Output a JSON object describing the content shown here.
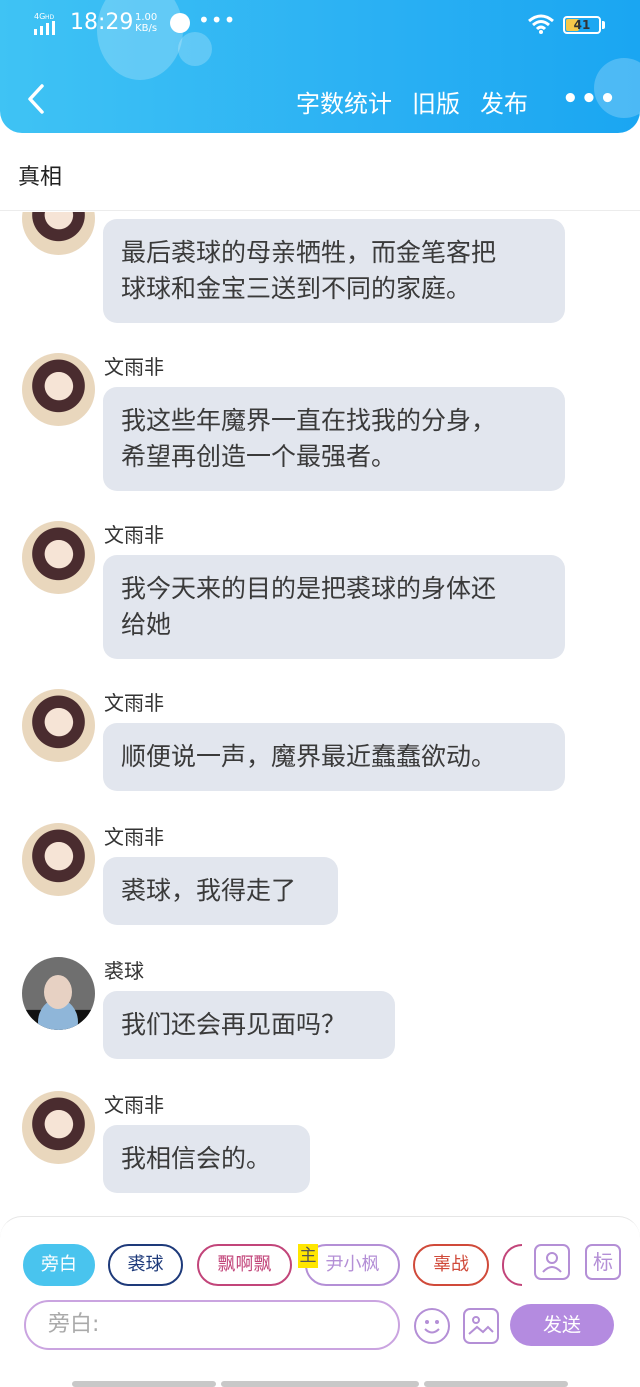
{
  "status_bar": {
    "network": "4G",
    "network_hd": "HD",
    "time": "18:29",
    "speed_value": "1.00",
    "speed_unit": "KB/s",
    "more": "•••",
    "battery": "41"
  },
  "header": {
    "actions": [
      "字数统计",
      "旧版",
      "发布"
    ],
    "more": "•••"
  },
  "story_title": "真相",
  "messages": [
    {
      "speaker": "",
      "avatar": "girl-avatar",
      "text": "最后裘球的母亲牺牲，而金笔客把\n球球和金宝三送到不同的家庭。"
    },
    {
      "speaker": "文雨非",
      "avatar": "girl-avatar",
      "text": "我这些年魔界一直在找我的分身，\n希望再创造一个最强者。"
    },
    {
      "speaker": "文雨非",
      "avatar": "girl-avatar",
      "text": "我今天来的目的是把裘球的身体还\n给她"
    },
    {
      "speaker": "文雨非",
      "avatar": "girl-avatar",
      "text": "顺便说一声，魔界最近蠢蠢欲动。"
    },
    {
      "speaker": "文雨非",
      "avatar": "girl-avatar",
      "text": "裘球，我得走了"
    },
    {
      "speaker": "裘球",
      "avatar": "boy-avatar",
      "text": "我们还会再见面吗？"
    },
    {
      "speaker": "文雨非",
      "avatar": "girl-avatar",
      "text": "我相信会的。"
    }
  ],
  "roles": [
    {
      "label": "旁白",
      "color": "#49c4ee",
      "active": true
    },
    {
      "label": "裘球",
      "color": "#1e3a7a",
      "active": false
    },
    {
      "label": "飘啊飘",
      "color": "#c2457a",
      "active": false
    },
    {
      "label": "尹小枫",
      "color": "#b48fd6",
      "active": false
    },
    {
      "label": "辜战",
      "color": "#d04a3a",
      "active": false
    }
  ],
  "host_badge": "主",
  "tools": {
    "role_icon": "person-card-icon",
    "tag_label": "标"
  },
  "composer": {
    "placeholder": "旁白:",
    "send_label": "发送"
  }
}
